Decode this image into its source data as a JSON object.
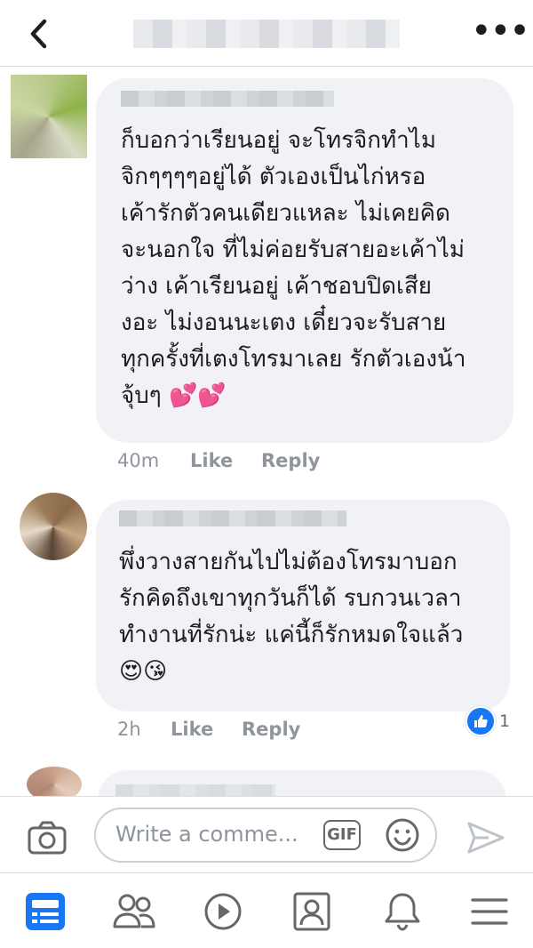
{
  "header": {
    "back_icon": "chevron-left-icon",
    "more_icon": "more-horizontal-icon",
    "more_glyph": "•••"
  },
  "comments": [
    {
      "text": "ก็บอกว่าเรียนอยู่ จะโทรจิกทำไม\nจิกๆๆๆๆอยู่ได้ ตัวเองเป็นไก่หรอ\nเค้ารักตัวคนเดียวแหละ ไม่เคยคิด\nจะนอกใจ ที่ไม่ค่อยรับสายอะเค้าไม่\nว่าง เค้าเรียนอยู่ เค้าชอบปิดเสีย\nงอะ ไม่งอนนะเตง เดี๋ยวจะรับสาย\nทุกครั้งที่เตงโทรมาเลย รักตัวเองน้า\nจุ้บๆ",
      "emojis": [
        "💕",
        "💕"
      ],
      "time": "40m",
      "like_label": "Like",
      "reply_label": "Reply"
    },
    {
      "text": "พึ่งวางสายกันไปไม่ต้องโทรมาบอก\nรักคิดถึงเขาทุกวันก็ได้ รบกวนเวลา\nทำงานที่รักน่ะ แค่นี้ก็รักหมดใจแล้ว",
      "emojis": [
        "😍",
        "😘"
      ],
      "time": "2h",
      "like_label": "Like",
      "reply_label": "Reply",
      "reaction_count": "1"
    }
  ],
  "composer": {
    "placeholder": "Write a comme...",
    "gif_label": "GIF",
    "camera_icon": "camera-icon",
    "emoji_icon": "smiley-icon",
    "send_icon": "send-icon"
  },
  "nav": {
    "items": [
      "news-feed-icon",
      "friends-icon",
      "watch-icon",
      "profile-icon",
      "notifications-icon",
      "menu-icon"
    ]
  },
  "colors": {
    "accent": "#1877f2",
    "bubble": "#f0f2f5",
    "muted": "#90949c"
  }
}
